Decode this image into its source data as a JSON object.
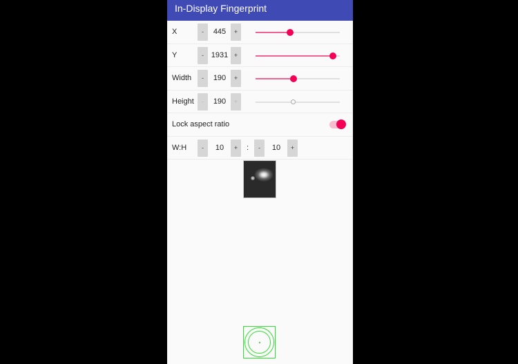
{
  "app": {
    "title": "In-Display Fingerprint"
  },
  "colors": {
    "appbar": "#3f4ab5",
    "accent": "#f50057",
    "overlay": "#33dd33"
  },
  "controls": {
    "x": {
      "label": "X",
      "minus": "-",
      "plus": "+",
      "value": "445",
      "slider_fraction": 0.41
    },
    "y": {
      "label": "Y",
      "minus": "-",
      "plus": "+",
      "value": "1931",
      "slider_fraction": 0.92
    },
    "width": {
      "label": "Width",
      "minus": "-",
      "plus": "+",
      "value": "190",
      "slider_fraction": 0.45
    },
    "height": {
      "label": "Height",
      "minus": "-",
      "plus": "+",
      "value": "190",
      "slider_fraction": 0.45,
      "disabled": true
    }
  },
  "lock": {
    "label": "Lock aspect ratio",
    "on": true
  },
  "ratio": {
    "label": "W:H",
    "minus": "-",
    "plus": "+",
    "w": "10",
    "h": "10",
    "separator": ":"
  },
  "icons": {
    "preview": "fingerprint-preview-image",
    "overlay": "fingerprint-target-icon"
  }
}
